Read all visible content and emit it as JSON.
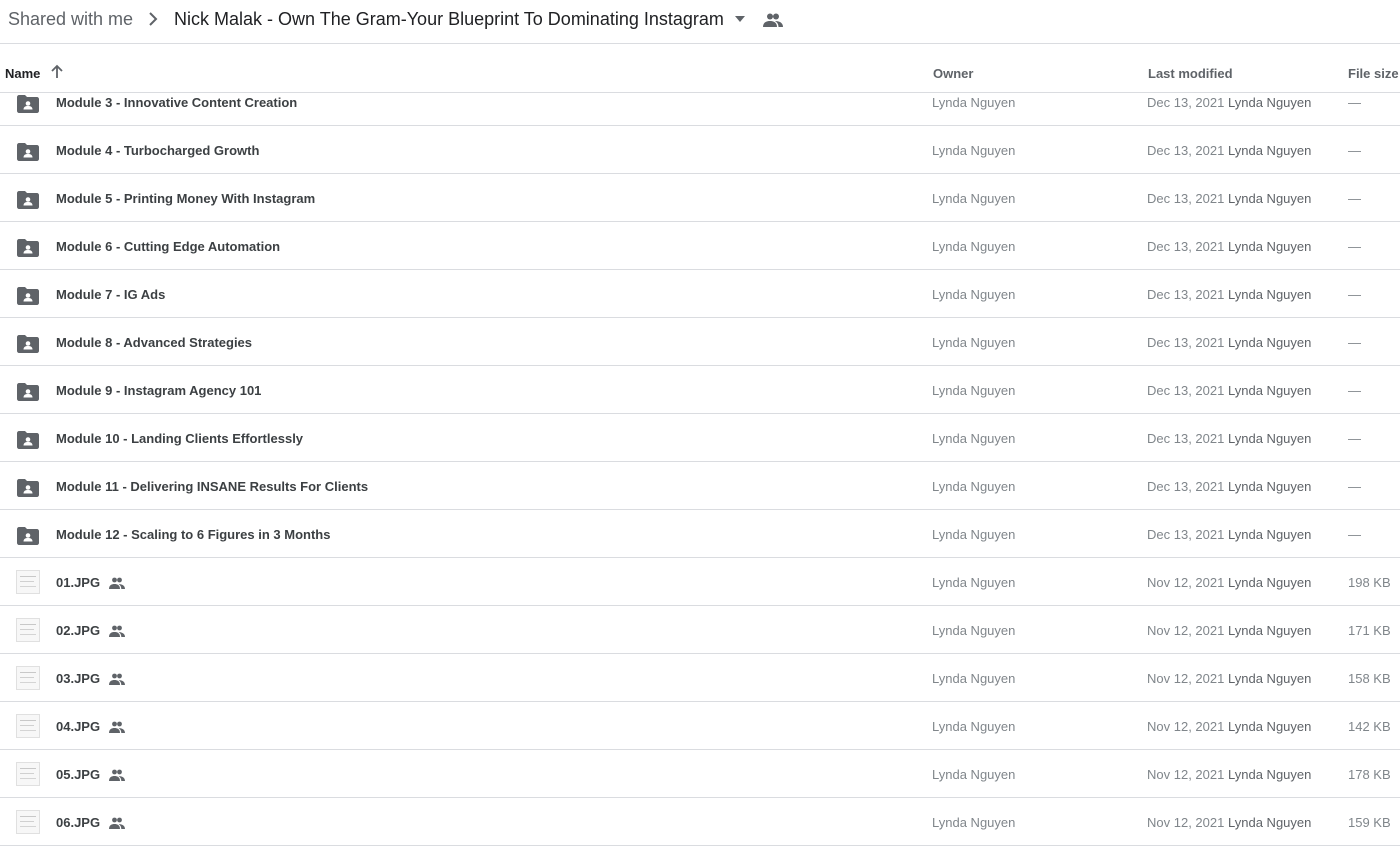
{
  "breadcrumb": {
    "root": "Shared with me",
    "current": "Nick Malak - Own The Gram-Your Blueprint To Dominating Instagram"
  },
  "columns": {
    "name": "Name",
    "owner": "Owner",
    "last_modified": "Last modified",
    "file_size": "File size"
  },
  "icons": {
    "folder": "shared-folder-icon",
    "file": "image-thumbnail",
    "shared": "people-icon",
    "sort": "arrow-up-icon"
  },
  "rows": [
    {
      "type": "folder",
      "name": "Module 3 - Innovative Content Creation",
      "owner": "Lynda Nguyen",
      "date": "Dec 13, 2021",
      "modified_by": "Lynda Nguyen",
      "size": "—",
      "shared": false
    },
    {
      "type": "folder",
      "name": "Module 4 - Turbocharged Growth",
      "owner": "Lynda Nguyen",
      "date": "Dec 13, 2021",
      "modified_by": "Lynda Nguyen",
      "size": "—",
      "shared": false
    },
    {
      "type": "folder",
      "name": "Module 5 - Printing Money With Instagram",
      "owner": "Lynda Nguyen",
      "date": "Dec 13, 2021",
      "modified_by": "Lynda Nguyen",
      "size": "—",
      "shared": false
    },
    {
      "type": "folder",
      "name": "Module 6 - Cutting Edge Automation",
      "owner": "Lynda Nguyen",
      "date": "Dec 13, 2021",
      "modified_by": "Lynda Nguyen",
      "size": "—",
      "shared": false
    },
    {
      "type": "folder",
      "name": "Module 7 - IG Ads",
      "owner": "Lynda Nguyen",
      "date": "Dec 13, 2021",
      "modified_by": "Lynda Nguyen",
      "size": "—",
      "shared": false
    },
    {
      "type": "folder",
      "name": "Module 8 - Advanced Strategies",
      "owner": "Lynda Nguyen",
      "date": "Dec 13, 2021",
      "modified_by": "Lynda Nguyen",
      "size": "—",
      "shared": false
    },
    {
      "type": "folder",
      "name": "Module 9 - Instagram Agency 101",
      "owner": "Lynda Nguyen",
      "date": "Dec 13, 2021",
      "modified_by": "Lynda Nguyen",
      "size": "—",
      "shared": false
    },
    {
      "type": "folder",
      "name": "Module 10 - Landing Clients Effortlessly",
      "owner": "Lynda Nguyen",
      "date": "Dec 13, 2021",
      "modified_by": "Lynda Nguyen",
      "size": "—",
      "shared": false
    },
    {
      "type": "folder",
      "name": "Module 11 - Delivering INSANE Results For Clients",
      "owner": "Lynda Nguyen",
      "date": "Dec 13, 2021",
      "modified_by": "Lynda Nguyen",
      "size": "—",
      "shared": false
    },
    {
      "type": "folder",
      "name": "Module 12 - Scaling to 6 Figures in 3 Months",
      "owner": "Lynda Nguyen",
      "date": "Dec 13, 2021",
      "modified_by": "Lynda Nguyen",
      "size": "—",
      "shared": false
    },
    {
      "type": "file",
      "name": "01.JPG",
      "owner": "Lynda Nguyen",
      "date": "Nov 12, 2021",
      "modified_by": "Lynda Nguyen",
      "size": "198 KB",
      "shared": true
    },
    {
      "type": "file",
      "name": "02.JPG",
      "owner": "Lynda Nguyen",
      "date": "Nov 12, 2021",
      "modified_by": "Lynda Nguyen",
      "size": "171 KB",
      "shared": true
    },
    {
      "type": "file",
      "name": "03.JPG",
      "owner": "Lynda Nguyen",
      "date": "Nov 12, 2021",
      "modified_by": "Lynda Nguyen",
      "size": "158 KB",
      "shared": true
    },
    {
      "type": "file",
      "name": "04.JPG",
      "owner": "Lynda Nguyen",
      "date": "Nov 12, 2021",
      "modified_by": "Lynda Nguyen",
      "size": "142 KB",
      "shared": true
    },
    {
      "type": "file",
      "name": "05.JPG",
      "owner": "Lynda Nguyen",
      "date": "Nov 12, 2021",
      "modified_by": "Lynda Nguyen",
      "size": "178 KB",
      "shared": true
    },
    {
      "type": "file",
      "name": "06.JPG",
      "owner": "Lynda Nguyen",
      "date": "Nov 12, 2021",
      "modified_by": "Lynda Nguyen",
      "size": "159 KB",
      "shared": true
    }
  ]
}
